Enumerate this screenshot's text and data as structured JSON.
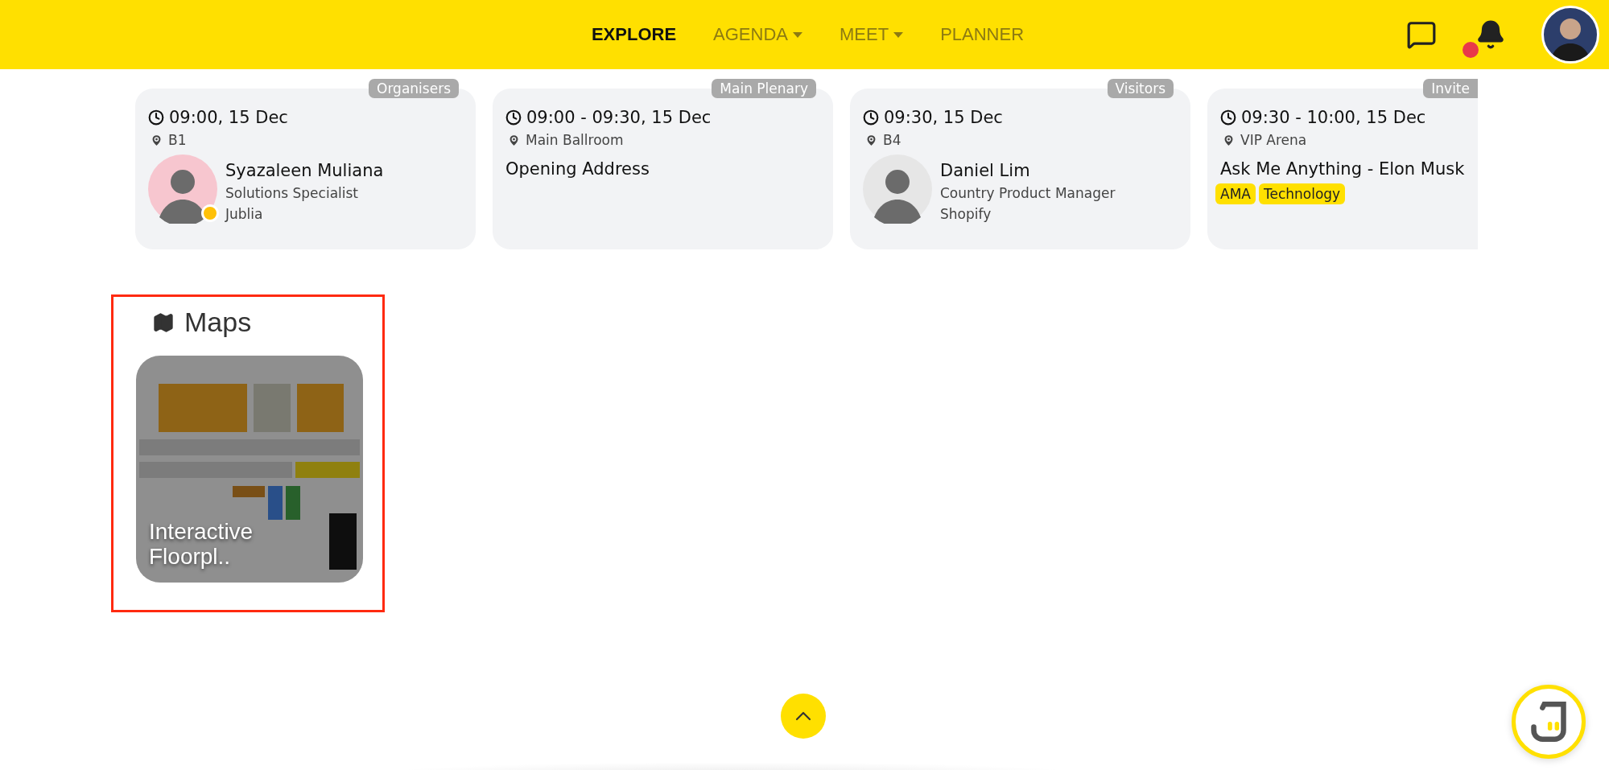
{
  "nav": {
    "items": [
      {
        "label": "EXPLORE",
        "selected": true,
        "has_menu": false
      },
      {
        "label": "AGENDA",
        "selected": false,
        "has_menu": true
      },
      {
        "label": "MEET",
        "selected": false,
        "has_menu": true
      },
      {
        "label": "PLANNER",
        "selected": false,
        "has_menu": false
      }
    ],
    "notifications": {
      "unread": true
    }
  },
  "sessions": [
    {
      "tag": "Organisers",
      "time": "09:00, 15 Dec",
      "location": "B1",
      "kind": "speaker",
      "speaker": {
        "name": "Syazaleen Muliana",
        "role": "Solutions Specialist",
        "company": "Jublia",
        "color": "#ffc107"
      }
    },
    {
      "tag": "Main Plenary",
      "time": "09:00 - 09:30, 15 Dec",
      "location": "Main Ballroom",
      "kind": "title",
      "title": "Opening Address"
    },
    {
      "tag": "Visitors",
      "time": "09:30, 15 Dec",
      "location": "B4",
      "kind": "speaker",
      "speaker": {
        "name": "Daniel Lim",
        "role": "Country Product Manager",
        "company": "Shopify"
      }
    },
    {
      "tag": "Invite",
      "time": "09:30 - 10:00, 15 Dec",
      "location": "VIP Arena",
      "kind": "title",
      "title": "Ask Me Anything - Elon Musk",
      "topics": [
        "AMA",
        "Technology"
      ]
    }
  ],
  "maps": {
    "heading": "Maps",
    "items": [
      {
        "label": "Interactive Floorpl..",
        "kind": "picture"
      }
    ]
  }
}
